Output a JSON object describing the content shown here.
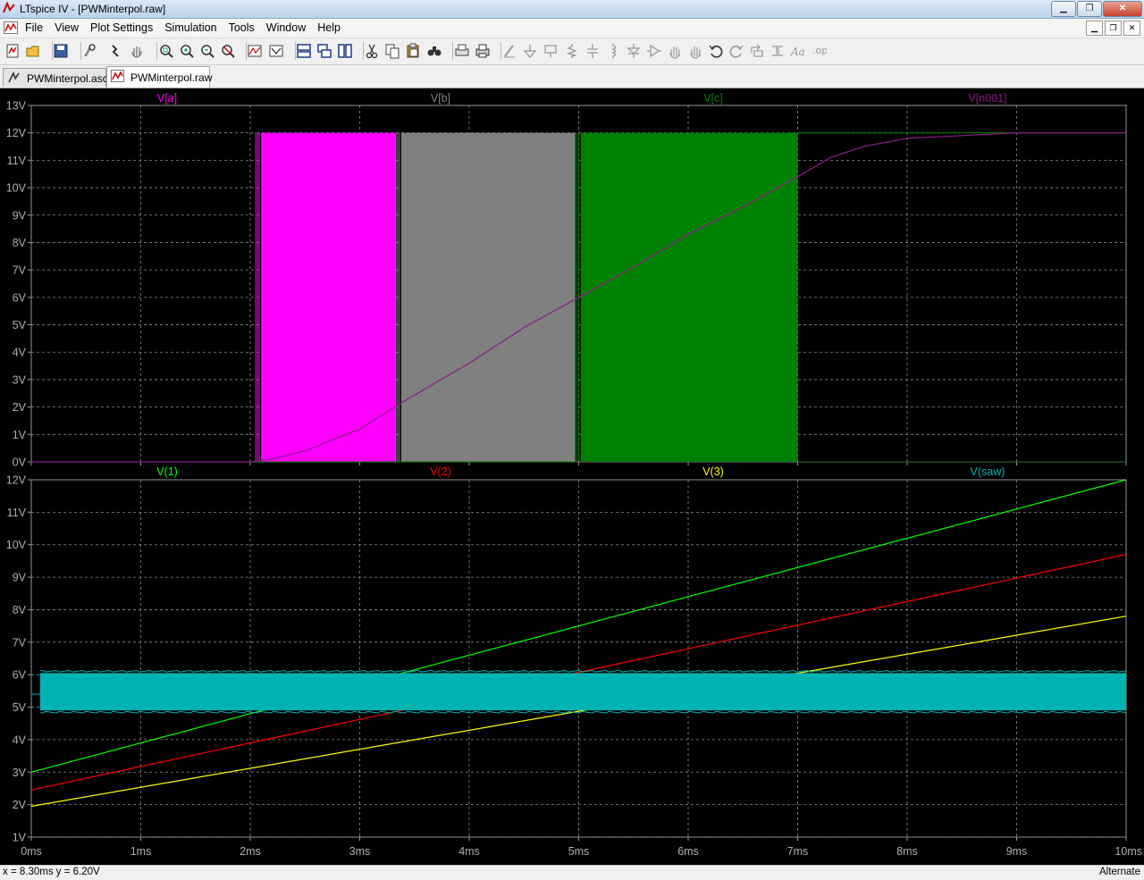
{
  "window": {
    "title": "LTspice IV - [PWMinterpol.raw]"
  },
  "menu": [
    "File",
    "View",
    "Plot Settings",
    "Simulation",
    "Tools",
    "Window",
    "Help"
  ],
  "toolbar": [
    "new-schematic",
    "open",
    "save",
    "control-panel",
    "run",
    "halt",
    "zoom-area",
    "zoom-in",
    "zoom-out",
    "zoom-fit",
    "autorange",
    "mark-data",
    "tile-horizontal",
    "cascade",
    "tile-vertical",
    "cut",
    "copy",
    "paste",
    "find",
    "print-preview",
    "print",
    "draw-wire",
    "ground",
    "label-net",
    "resistor",
    "capacitor",
    "inductor",
    "diode",
    "component",
    "move",
    "drag",
    "undo",
    "redo",
    "rotate",
    "mirror",
    "text",
    "spice-directive"
  ],
  "tabs": [
    {
      "label": "PWMinterpol.asc",
      "active": false
    },
    {
      "label": "PWMinterpol.raw",
      "active": true
    }
  ],
  "status": {
    "coords": "x = 8.30ms    y = 6.20V",
    "mode": "Alternate"
  },
  "chart_data": [
    {
      "type": "line",
      "pane": "top",
      "x": {
        "range": [
          0,
          10
        ],
        "ticks": [
          0,
          1,
          2,
          3,
          4,
          5,
          6,
          7,
          8,
          9,
          10
        ]
      },
      "ylim": [
        0,
        13
      ],
      "yticks": [
        "0V",
        "1V",
        "2V",
        "3V",
        "4V",
        "5V",
        "6V",
        "7V",
        "8V",
        "9V",
        "10V",
        "11V",
        "12V",
        "13V"
      ],
      "series": [
        {
          "name": "V[a]",
          "color": "#ff00ff",
          "kind": "pwm",
          "high": 12,
          "low": 0,
          "active": [
            2.05,
            3.33
          ]
        },
        {
          "name": "V[b]",
          "color": "#808080",
          "kind": "pwm",
          "high": 12,
          "low": 0,
          "active": [
            3.33,
            4.97
          ]
        },
        {
          "name": "V[c]",
          "color": "#008000",
          "kind": "pwm",
          "high": 12,
          "low": 0,
          "active": [
            4.97,
            7.0
          ],
          "after": 12
        },
        {
          "name": "V[n001]",
          "color": "#8b1a89",
          "kind": "line",
          "x": [
            0,
            2.0,
            2.2,
            2.5,
            3.0,
            3.4,
            4.0,
            4.5,
            5.0,
            5.5,
            6.0,
            6.5,
            7.0,
            7.3,
            7.6,
            8.0,
            8.5,
            9.0,
            10.0
          ],
          "y": [
            0,
            0,
            0.1,
            0.4,
            1.2,
            2.2,
            3.6,
            4.9,
            6.0,
            7.1,
            8.3,
            9.3,
            10.4,
            11.1,
            11.5,
            11.8,
            11.9,
            12.0,
            12.0
          ]
        }
      ]
    },
    {
      "type": "line",
      "pane": "bottom",
      "x": {
        "range": [
          0,
          10
        ],
        "ticks": [
          0,
          1,
          2,
          3,
          4,
          5,
          6,
          7,
          8,
          9,
          10
        ],
        "ticklabels": [
          "0ms",
          "1ms",
          "2ms",
          "3ms",
          "4ms",
          "5ms",
          "6ms",
          "7ms",
          "8ms",
          "9ms",
          "10ms"
        ]
      },
      "ylim": [
        1,
        12
      ],
      "yticks": [
        "1V",
        "2V",
        "3V",
        "4V",
        "5V",
        "6V",
        "7V",
        "8V",
        "9V",
        "10V",
        "11V",
        "12V"
      ],
      "series": [
        {
          "name": "V(1)",
          "color": "#00ff00",
          "kind": "line",
          "x": [
            0,
            10
          ],
          "y": [
            3.0,
            12.0
          ]
        },
        {
          "name": "V(2)",
          "color": "#ff0000",
          "kind": "line",
          "x": [
            0,
            10
          ],
          "y": [
            2.45,
            9.7
          ]
        },
        {
          "name": "V(3)",
          "color": "#ffff00",
          "kind": "line",
          "x": [
            0,
            10
          ],
          "y": [
            1.95,
            7.8
          ]
        },
        {
          "name": "V(saw)",
          "color": "#00b3b3",
          "kind": "band",
          "x_start": 0.08,
          "low": 4.9,
          "high": 6.05
        }
      ]
    }
  ]
}
